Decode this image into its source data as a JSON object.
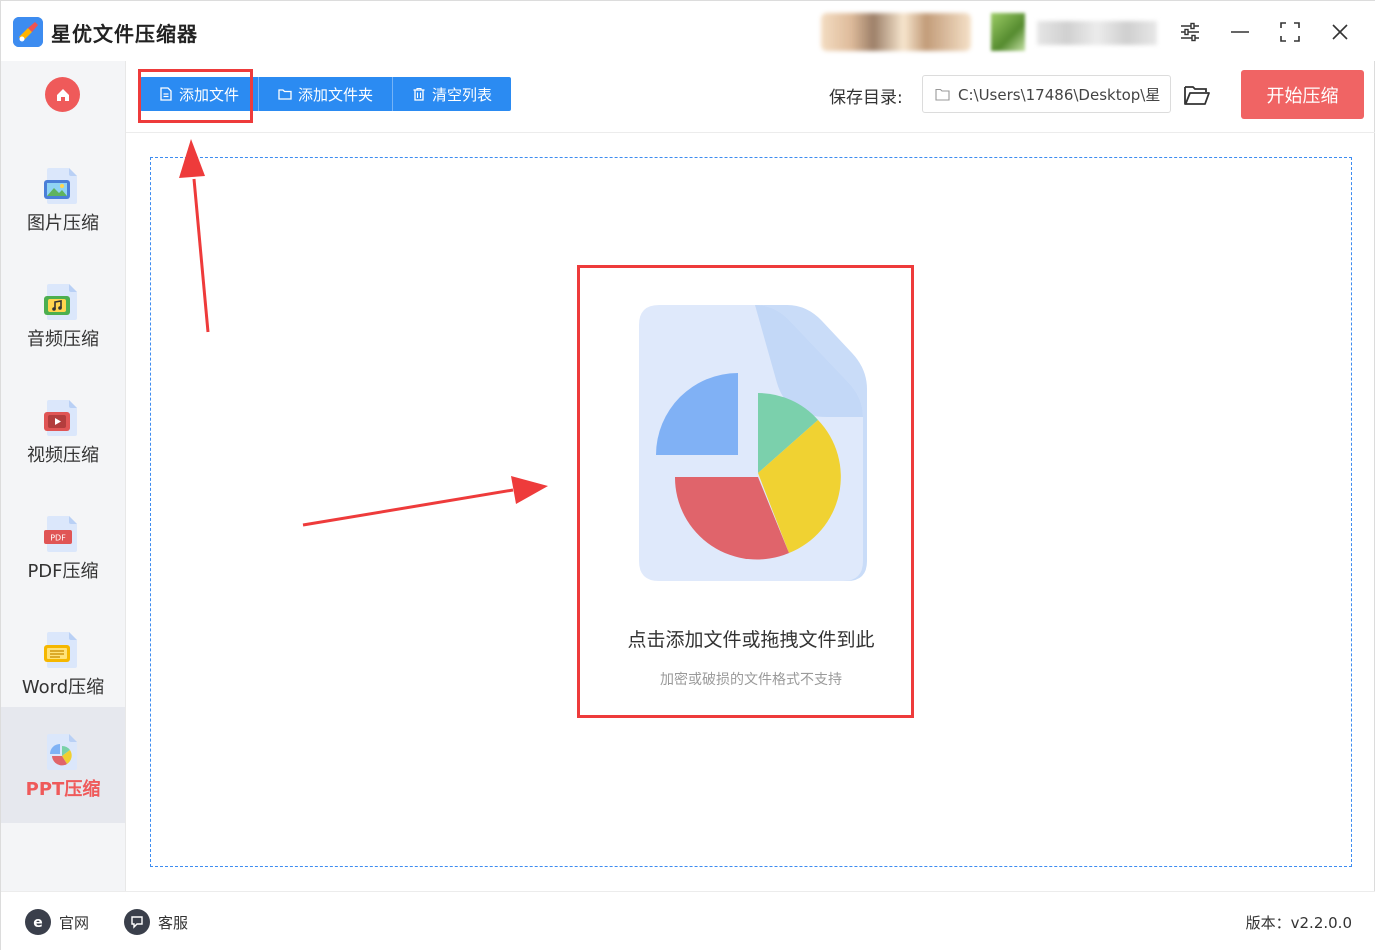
{
  "window": {
    "title": "星优文件压缩器"
  },
  "sidebar": {
    "items": [
      {
        "label": "图片压缩",
        "icon": "image-file-icon"
      },
      {
        "label": "音频压缩",
        "icon": "audio-file-icon"
      },
      {
        "label": "视频压缩",
        "icon": "video-file-icon"
      },
      {
        "label": "PDF压缩",
        "icon": "pdf-file-icon"
      },
      {
        "label": "Word压缩",
        "icon": "word-file-icon"
      },
      {
        "label": "PPT压缩",
        "icon": "ppt-file-icon",
        "active": true
      }
    ]
  },
  "toolbar": {
    "add_file": "添加文件",
    "add_folder": "添加文件夹",
    "clear_list": "清空列表",
    "save_dir_label": "保存目录:",
    "save_dir_value": "C:\\Users\\17486\\Desktop\\星",
    "start_button": "开始压缩"
  },
  "dropzone": {
    "main_text": "点击添加文件或拖拽文件到此",
    "sub_text": "加密或破损的文件格式不支持"
  },
  "footer": {
    "website": "官网",
    "support": "客服",
    "version": "版本：v2.2.0.0"
  },
  "colors": {
    "accent_blue": "#2b8bf2",
    "accent_red": "#f06464",
    "annotation_red": "#ee3b3b",
    "active_nav_text": "#ef5a5a"
  }
}
